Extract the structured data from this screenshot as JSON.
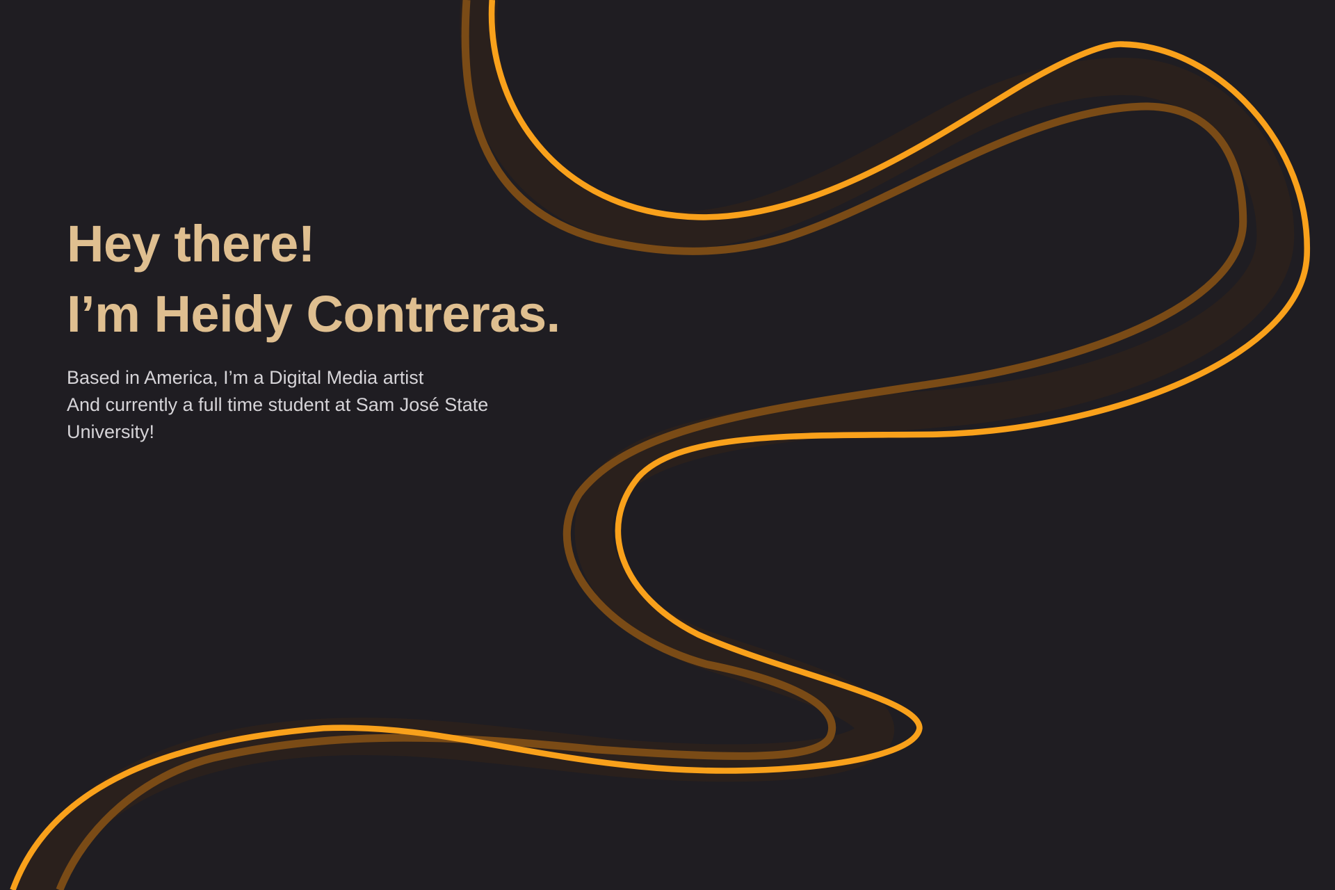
{
  "hero": {
    "greeting": "Hey there!",
    "name_line": "I’m Heidy Contreras.",
    "bio_lines": [
      "Based in America, I’m a Digital Media artist",
      "And currently a full time student at Sam José State",
      "University!"
    ]
  },
  "colors": {
    "background": "#1f1d22",
    "heading": "#dfbf90",
    "ribbon_edge": "#f9a11b",
    "ribbon_inner": "#7a4b16",
    "ribbon_fill": "#2a201c"
  }
}
